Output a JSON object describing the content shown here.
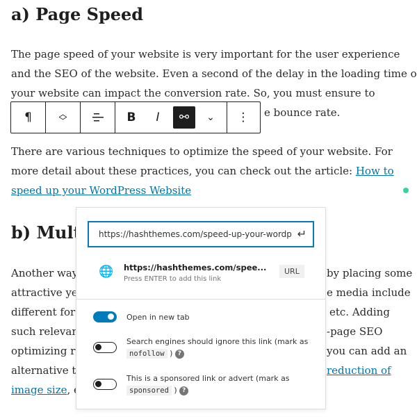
{
  "heading_a": "a) Page Speed",
  "p1": [
    "The page speed of your website is very important for the user experience",
    "and the SEO of the website. Even a second of the delay in the loading time of",
    "your website can impact the conversion rate. So, you must ensure to",
    "e bounce rate."
  ],
  "p2": [
    "There are various techniques to optimize the speed of your website. For",
    "more detail about these practices, you can check out the article: "
  ],
  "p2_link": [
    "How to",
    "speed up your WordPress Website"
  ],
  "heading_b": "b) Mult",
  "p3_left": [
    "Another way",
    "attractive ye",
    "different for",
    "such relevan",
    "optimizing r",
    "alternative t"
  ],
  "p3_right": [
    "by placing some",
    "e media include",
    "etc. Adding",
    "-page SEO",
    "you can add an"
  ],
  "p3_link": [
    "reduction of",
    "image size"
  ],
  "p3_tail": ", e",
  "toolbar": {
    "paragraph": "¶",
    "move": "⌃⌄",
    "align": "align-icon",
    "bold": "B",
    "italic": "I",
    "more_chevron": "⌄",
    "options": "⋮"
  },
  "link_popover": {
    "url_value": "https://hashthemes.com/speed-up-your-wordp",
    "suggestion_title": "https://hashthemes.com/spee...",
    "suggestion_hint": "Press ENTER to add this link",
    "suggestion_type": "URL",
    "opt_new_tab": "Open in new tab",
    "new_tab_on": true,
    "opt_nofollow_pre": "Search engines should ignore this link (mark as",
    "nofollow": "nofollow",
    "opt_sponsored_pre": "This is a sponsored link or advert (mark as",
    "sponsored": "sponsored",
    "close_paren": ")",
    "help": "?"
  },
  "colors": {
    "accent": "#007cba",
    "link": "#0073aa",
    "dot": "#3ccfa0"
  }
}
